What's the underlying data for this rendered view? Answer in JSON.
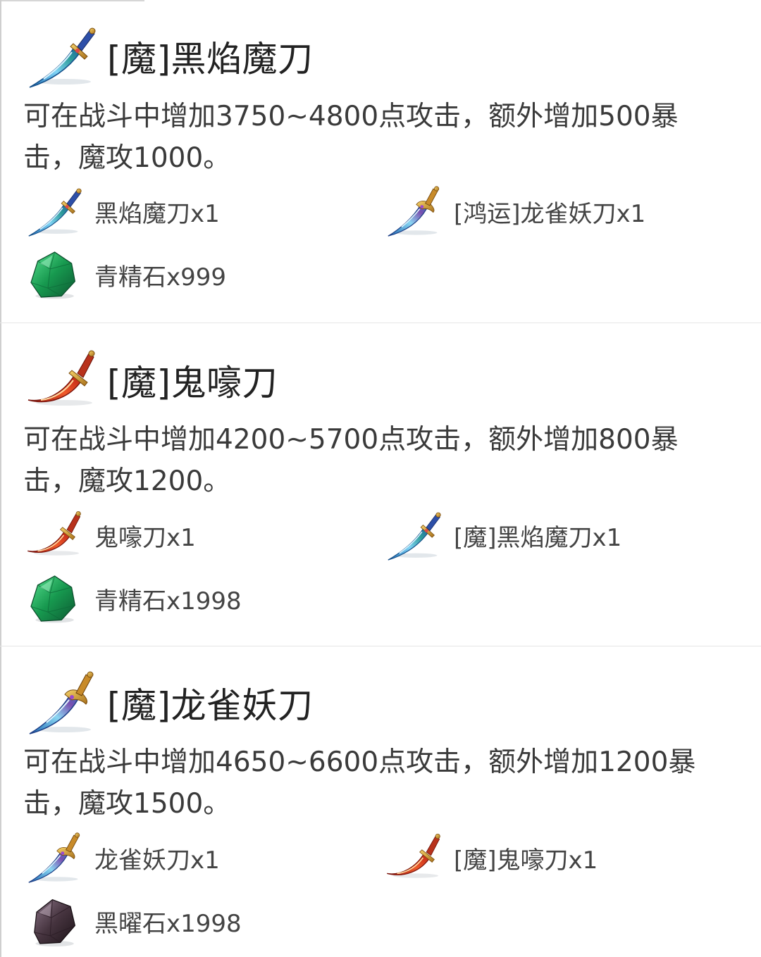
{
  "items": [
    {
      "title": "[魔]黑焰魔刀",
      "icon": "blue-dark-flame-blade-icon",
      "description": "可在战斗中增加3750~4800点攻击，额外增加500暴击，魔攻1000。",
      "materials": [
        {
          "label": "黑焰魔刀x1",
          "icon": "blue-dark-flame-blade-icon"
        },
        {
          "label": "[鸿运]龙雀妖刀x1",
          "icon": "dragon-sparrow-blade-icon"
        },
        {
          "label": "青精石x999",
          "icon": "green-gem-icon"
        }
      ]
    },
    {
      "title": "[魔]鬼嚎刀",
      "icon": "red-ghost-howl-blade-icon",
      "description": "可在战斗中增加4200~5700点攻击，额外增加800暴击，魔攻1200。",
      "materials": [
        {
          "label": "鬼嚎刀x1",
          "icon": "red-ghost-howl-blade-icon"
        },
        {
          "label": "[魔]黑焰魔刀x1",
          "icon": "blue-dark-flame-blade-icon"
        },
        {
          "label": "青精石x1998",
          "icon": "green-gem-icon"
        }
      ]
    },
    {
      "title": "[魔]龙雀妖刀",
      "icon": "dragon-sparrow-blade-icon",
      "description": "可在战斗中增加4650~6600点攻击，额外增加1200暴击，魔攻1500。",
      "materials": [
        {
          "label": "龙雀妖刀x1",
          "icon": "dragon-sparrow-blade-icon"
        },
        {
          "label": "[魔]鬼嚎刀x1",
          "icon": "red-ghost-howl-blade-icon"
        },
        {
          "label": "黑曜石x1998",
          "icon": "obsidian-stone-icon"
        }
      ]
    }
  ],
  "colors": {
    "blue_blade": "#3aa0e0",
    "red_blade": "#d8321e",
    "green_gem": "#1fa35a",
    "obsidian": "#4a3848",
    "gold_hilt": "#d9a12a"
  }
}
